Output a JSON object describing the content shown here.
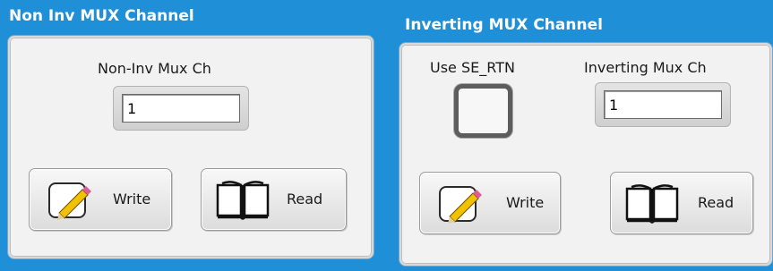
{
  "non_inv_group": {
    "title": "Non Inv MUX Channel",
    "field_label": "Non-Inv Mux Ch",
    "field_value": "1",
    "write_label": "Write",
    "read_label": "Read"
  },
  "inv_group": {
    "title": "Inverting MUX Channel",
    "checkbox_label": "Use SE_RTN",
    "checkbox_checked": false,
    "field_label": "Inverting Mux Ch",
    "field_value": "1",
    "write_label": "Write",
    "read_label": "Read"
  },
  "icons": {
    "write": "pencil-paper-icon",
    "read": "open-book-icon"
  },
  "colors": {
    "background": "#1f8fd8",
    "panel": "#f2f2f2",
    "pencil": "#f2c200",
    "pencil_tip": "#e05a9a"
  }
}
